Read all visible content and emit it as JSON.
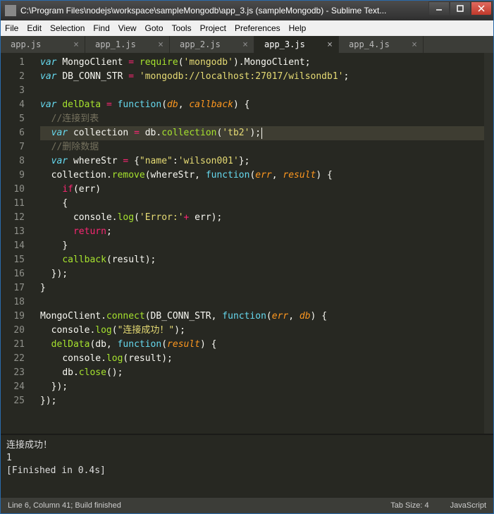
{
  "window": {
    "title": "C:\\Program Files\\nodejs\\workspace\\sampleMongodb\\app_3.js (sampleMongodb) - Sublime Text..."
  },
  "menubar": [
    "File",
    "Edit",
    "Selection",
    "Find",
    "View",
    "Goto",
    "Tools",
    "Project",
    "Preferences",
    "Help"
  ],
  "tabs": [
    {
      "label": "app.js",
      "active": false
    },
    {
      "label": "app_1.js",
      "active": false
    },
    {
      "label": "app_2.js",
      "active": false
    },
    {
      "label": "app_3.js",
      "active": true
    },
    {
      "label": "app_4.js",
      "active": false
    }
  ],
  "editor": {
    "line_numbers": [
      "1",
      "2",
      "3",
      "4",
      "5",
      "6",
      "7",
      "8",
      "9",
      "10",
      "11",
      "12",
      "13",
      "14",
      "15",
      "16",
      "17",
      "18",
      "19",
      "20",
      "21",
      "22",
      "23",
      "24",
      "25"
    ],
    "highlight_line": 6,
    "code_plain": "var MongoClient = require('mongodb').MongoClient;\nvar DB_CONN_STR = 'mongodb://localhost:27017/wilsondb1';\n\nvar delData = function(db, callback) {\n  //连接到表\n  var collection = db.collection('tb2');\n  //删除数据\n  var whereStr = {\"name\":'wilson001'};\n  collection.remove(whereStr, function(err, result) {\n    if(err)\n    {\n      console.log('Error:'+ err);\n      return;\n    }\n    callback(result);\n  });\n}\n\nMongoClient.connect(DB_CONN_STR, function(err, db) {\n  console.log(\"连接成功！\");\n  delData(db, function(result) {\n    console.log(result);\n    db.close();\n  });\n});"
  },
  "output": {
    "lines": [
      "连接成功！",
      "1",
      "[Finished in 0.4s]"
    ]
  },
  "statusbar": {
    "left": "Line 6, Column 41; Build finished",
    "tab_size": "Tab Size: 4",
    "lang": "JavaScript"
  }
}
